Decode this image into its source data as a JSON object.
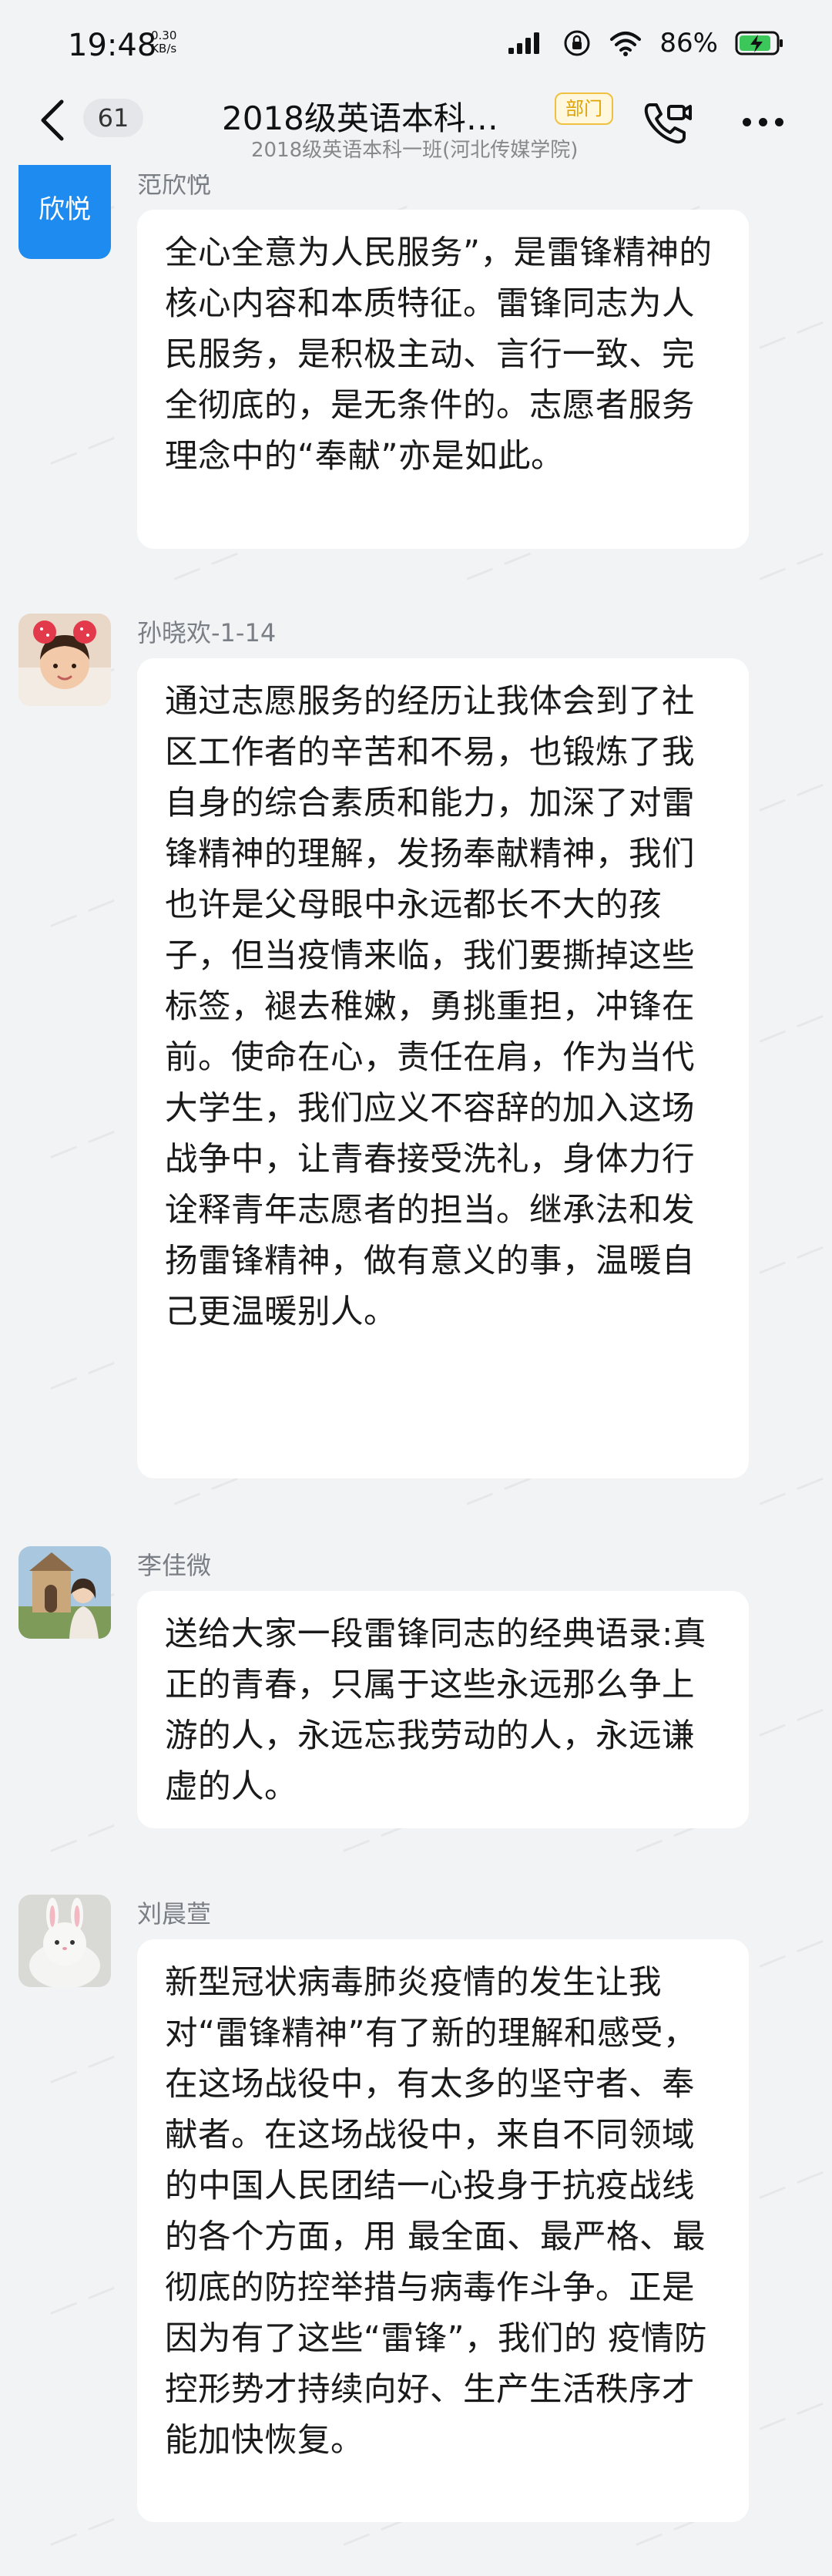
{
  "status_bar": {
    "time": "19:48",
    "net_speed_value": "0.30",
    "net_speed_unit": "KB/s",
    "battery_percent": "86%"
  },
  "header": {
    "back_count": "61",
    "title": "2018级英语本科…",
    "tag": "部门",
    "subtitle": "2018级英语本科一班(河北传媒学院)"
  },
  "messages": [
    {
      "sender": "范欣悦",
      "avatar_text": "欣悦",
      "avatar_color": "#1e8bf0",
      "text": "全心全意为人民服务”，是雷锋精神的核心内容和本质特征。雷锋同志为人民服务，是积极主动、言行一致、完全彻底的，是无条件的。志愿者服务理念中的“奉献”亦是如此。"
    },
    {
      "sender": "孙晓欢-1-14",
      "text": "通过志愿服务的经历让我体会到了社区工作者的辛苦和不易，也锻炼了我自身的综合素质和能力，加深了对雷锋精神的理解，发扬奉献精神，我们也许是父母眼中永远都长不大的孩子，但当疫情来临，我们要撕掉这些标签，褪去稚嫩，勇挑重担，冲锋在前。使命在心，责任在肩，作为当代大学生，我们应义不容辞的加入这场战争中，让青春接受洗礼，身体力行诠释青年志愿者的担当。继承法和发扬雷锋精神，做有意义的事，温暖自己更温暖别人。"
    },
    {
      "sender": "李佳微",
      "text": "送给大家一段雷锋同志的经典语录:真正的青春，只属于这些永远那么争上游的人，永远忘我劳动的人，永远谦虚的人。"
    },
    {
      "sender": "刘晨萱",
      "text": "新型冠状病毒肺炎疫情的发生让我对“雷锋精神”有了新的理解和感受，在这场战役中，有太多的坚守者、奉献者。在这场战役中，来自不同领域的中国人民团结一心投身于抗疫战线的各个方面，用 最全面、最严格、最彻底的防控举措与病毒作斗争。正是因为有了这些“雷锋”，我们的 疫情防控形势才持续向好、生产生活秩序才能加快恢复。"
    }
  ]
}
